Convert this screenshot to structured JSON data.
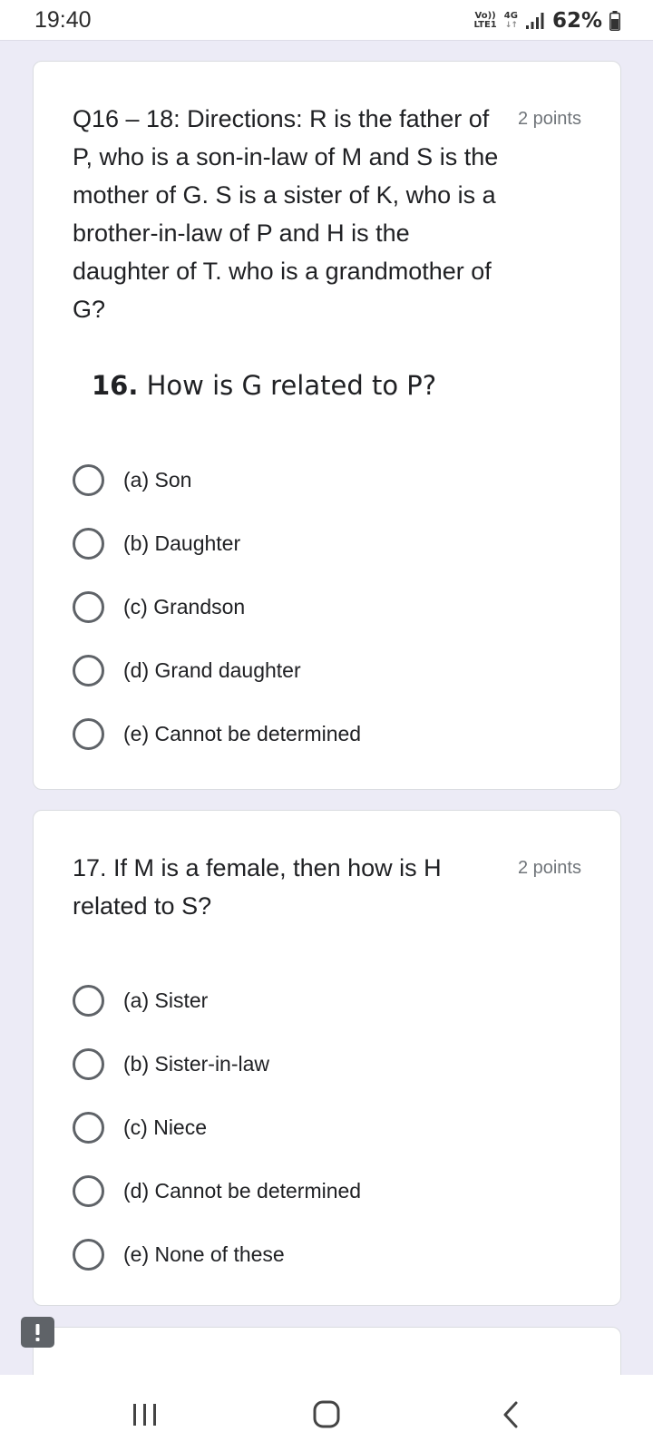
{
  "status_bar": {
    "time": "19:40",
    "volte_top": "Vo))",
    "volte_bottom": "LTE1",
    "network_type": "4G",
    "network_arrows": "↓↑",
    "battery": "62%"
  },
  "q16": {
    "text": "Q16 – 18: Directions: R is the father of P, who is a son-in-law of M and S is the mother of G. S is a sister of K, who is a brother-in-law of P and H is the daughter of T. who is a grandmother of G?",
    "points": "2 points",
    "sub_number": "16.",
    "sub_text": "How is G related to P?",
    "options": [
      "(a) Son",
      "(b) Daughter",
      "(c) Grandson",
      "(d) Grand daughter",
      "(e) Cannot be determined"
    ]
  },
  "q17": {
    "text": "17. If M is a female, then how is H related to S?",
    "points": "2 points",
    "options": [
      "(a) Sister",
      "(b) Sister-in-law",
      "(c) Niece",
      "(d) Cannot be determined",
      "(e) None of these"
    ]
  },
  "colors": {
    "background": "#ecebf6",
    "card": "#ffffff",
    "radio_border": "#5f6368",
    "points_text": "#70757a"
  },
  "icons": {
    "feedback": "exclamation-icon",
    "nav_recents": "recents-icon",
    "nav_home": "home-icon",
    "nav_back": "back-icon"
  }
}
